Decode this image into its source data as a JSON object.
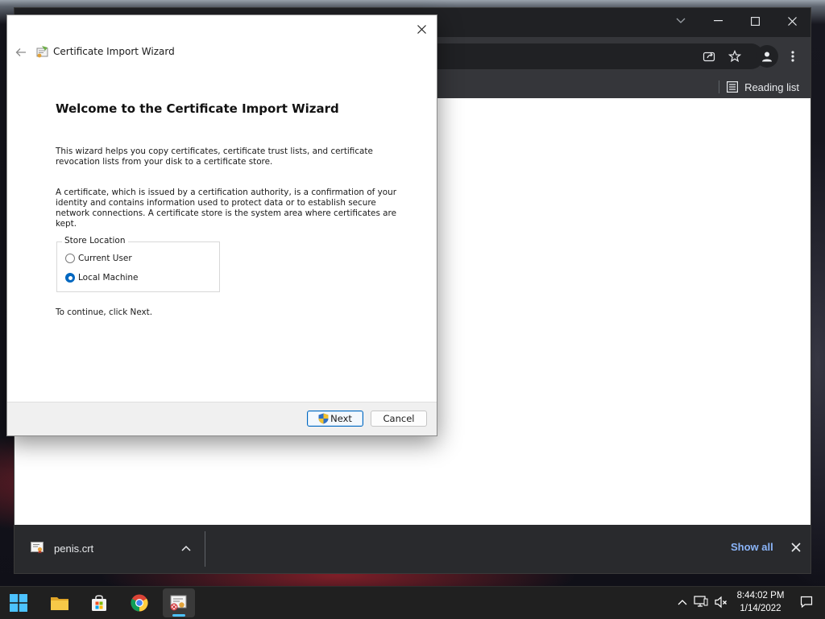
{
  "wizard": {
    "window_title": "Certificate Import Wizard",
    "heading": "Welcome to the Certificate Import Wizard",
    "paragraph1": "This wizard helps you copy certificates, certificate trust lists, and certificate revocation lists from your disk to a certificate store.",
    "paragraph2": "A certificate, which is issued by a certification authority, is a confirmation of your identity and contains information used to protect data or to establish secure network connections. A certificate store is the system area where certificates are kept.",
    "store_location": {
      "label": "Store Location",
      "options": [
        {
          "label": "Current User",
          "selected": false
        },
        {
          "label": "Local Machine",
          "selected": true
        }
      ]
    },
    "continue_text": "To continue, click Next.",
    "buttons": {
      "next": "Next",
      "cancel": "Cancel"
    }
  },
  "browser": {
    "reading_list_label": "Reading list",
    "download": {
      "filename": "penis.crt",
      "show_all": "Show all"
    }
  },
  "taskbar": {
    "apps": [
      "start-icon",
      "file-explorer-icon",
      "microsoft-store-icon",
      "chrome-icon",
      "certificate-app-icon"
    ],
    "clock_time": "8:44:02 PM",
    "clock_date": "1/14/2022"
  },
  "colors": {
    "accent": "#0067c0",
    "link": "#8ab4f8",
    "chrome_dark": "#202124",
    "taskbar": "#202020"
  }
}
